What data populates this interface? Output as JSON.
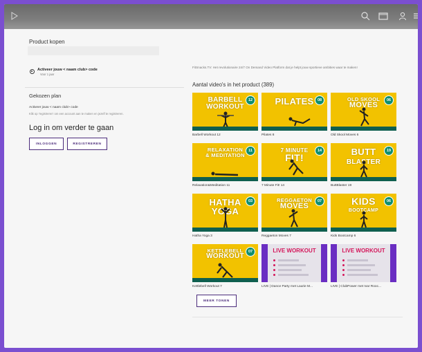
{
  "topbar": {
    "icons": [
      "play-icon",
      "search-icon",
      "cast-icon",
      "user-icon",
      "menu-icon"
    ]
  },
  "left": {
    "buy_title": "Product kopen",
    "activate_label": "Activeer jouw < naam club> code",
    "activate_sub": "Voor 1 jaar",
    "plan_title": "Gekozen plan",
    "plan_line1": "Activeer jouw < naam club> code",
    "plan_line2": "Klik op 'registreren' om een account aan te maken en jezelf te registreren.",
    "login_title": "Log in om verder te gaan",
    "login_button": "INLOGGEN",
    "register_button": "REGISTREREN"
  },
  "right": {
    "intro": "FitSnacks.TV: Het revolutionaire 24/7 On Demand Video Platform dat je helpt jouw sportieve ambities waar te maken!",
    "count_title": "Aantal video's in het product (389)",
    "more_button": "MEER TONEN",
    "cards": [
      {
        "caption": "Barbell Workout 12",
        "title1": "BARBELL",
        "title2": "WORKOUT",
        "badge": "12"
      },
      {
        "caption": "Pilates 8",
        "title1": "PILATES",
        "title2": "",
        "badge": "08"
      },
      {
        "caption": "Old Skool Moves 6",
        "title1": "OLD SKOOL",
        "title2": "MOVES",
        "badge": "06"
      },
      {
        "caption": "Relaxation&Meditation 11",
        "title1": "RELAXATION",
        "title2": "& MEDITATION",
        "badge": "11"
      },
      {
        "caption": "7 Minute Fit! 14",
        "title1": "7 MINUTE",
        "title2": "FIT!",
        "badge": "14"
      },
      {
        "caption": "ButtBlaster 19",
        "title1": "BUTT",
        "title2": "BLASTER",
        "badge": "19"
      },
      {
        "caption": "Hatha Yoga 3",
        "title1": "HATHA",
        "title2": "YOGA",
        "badge": "03"
      },
      {
        "caption": "Reggaeton Moves 7",
        "title1": "REGGAETON",
        "title2": "MOVES",
        "badge": "07"
      },
      {
        "caption": "Kids Bootcamp 6",
        "title1": "KIDS",
        "title2": "BOOTCAMP",
        "badge": "06"
      },
      {
        "caption": "Kettlebell Workout 7",
        "title1": "KETTLEBELL",
        "title2": "WORKOUT",
        "badge": "07"
      },
      {
        "caption": "LIVE | Dance Party met Laurie M...",
        "title1": "LIVE WORKOUT",
        "title2": "",
        "badge": ""
      },
      {
        "caption": "LIVE | ClubPower met Ivar Rooc...",
        "title1": "LIVE WORKOUT",
        "title2": "",
        "badge": ""
      }
    ]
  },
  "colors": {
    "thumb_yellow": "#f2c200",
    "badge_green": "#0f8f6f",
    "brand_purple": "#4a2a7a",
    "live_red": "#d4165a",
    "live_purple": "#6a2ec2"
  }
}
